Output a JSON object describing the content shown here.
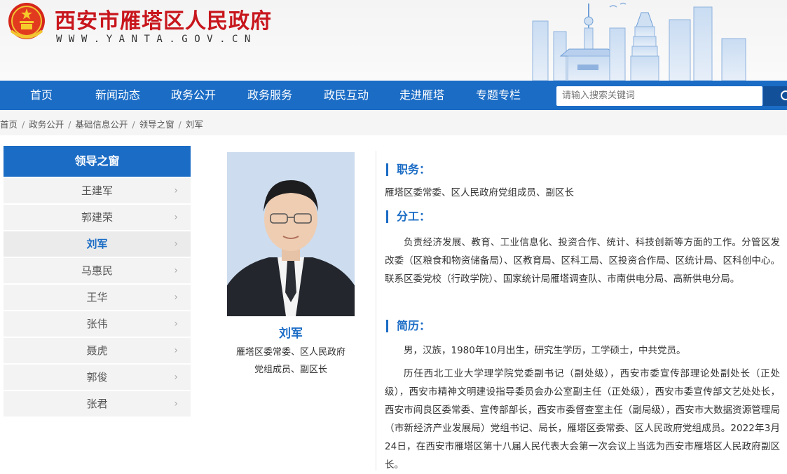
{
  "header": {
    "site_title": "西安市雁塔区人民政府",
    "site_url": "WWW.YANTA.GOV.CN",
    "brand_color": "#c8161d"
  },
  "nav": {
    "items": [
      "首页",
      "新闻动态",
      "政务公开",
      "政务服务",
      "政民互动",
      "走进雁塔",
      "专题专栏"
    ],
    "search_placeholder": "请输入搜索关键词",
    "color": "#1b6cc5"
  },
  "breadcrumb": [
    "首页",
    "政务公开",
    "基础信息公开",
    "领导之窗",
    "刘军"
  ],
  "sidebar": {
    "title": "领导之窗",
    "items": [
      {
        "label": "王建军"
      },
      {
        "label": "郭建荣"
      },
      {
        "label": "刘军",
        "active": true
      },
      {
        "label": "马惠民"
      },
      {
        "label": "王华"
      },
      {
        "label": "张伟"
      },
      {
        "label": "聂虎"
      },
      {
        "label": "郭俊"
      },
      {
        "label": "张君"
      }
    ],
    "chevron": "›"
  },
  "profile": {
    "name": "刘军",
    "title_line1": "雁塔区委常委、区人民政府",
    "title_line2": "党组成员、副区长"
  },
  "content": {
    "duty_label": "职务：",
    "duty_text": "雁塔区委常委、区人民政府党组成员、副区长",
    "division_label": "分工：",
    "division_text": "负责经济发展、教育、工业信息化、投资合作、统计、科技创新等方面的工作。分管区发改委（区粮食和物资储备局）、区教育局、区科工局、区投资合作局、区统计局、区科创中心。联系区委党校（行政学院）、国家统计局雁塔调查队、市南供电分局、高新供电分局。",
    "resume_label": "简历：",
    "resume_p1": "男，汉族，1980年10月出生，研究生学历，工学硕士，中共党员。",
    "resume_p2": "历任西北工业大学理学院党委副书记（副处级），西安市委宣传部理论处副处长（正处级），西安市精神文明建设指导委员会办公室副主任（正处级），西安市委宣传部文艺处处长，西安市阎良区委常委、宣传部部长，西安市委督查室主任（副局级），西安市大数据资源管理局（市新经济产业发展局）党组书记、局长，雁塔区委常委、区人民政府党组成员。2022年3月24日，在西安市雁塔区第十八届人民代表大会第一次会议上当选为西安市雁塔区人民政府副区长。"
  }
}
